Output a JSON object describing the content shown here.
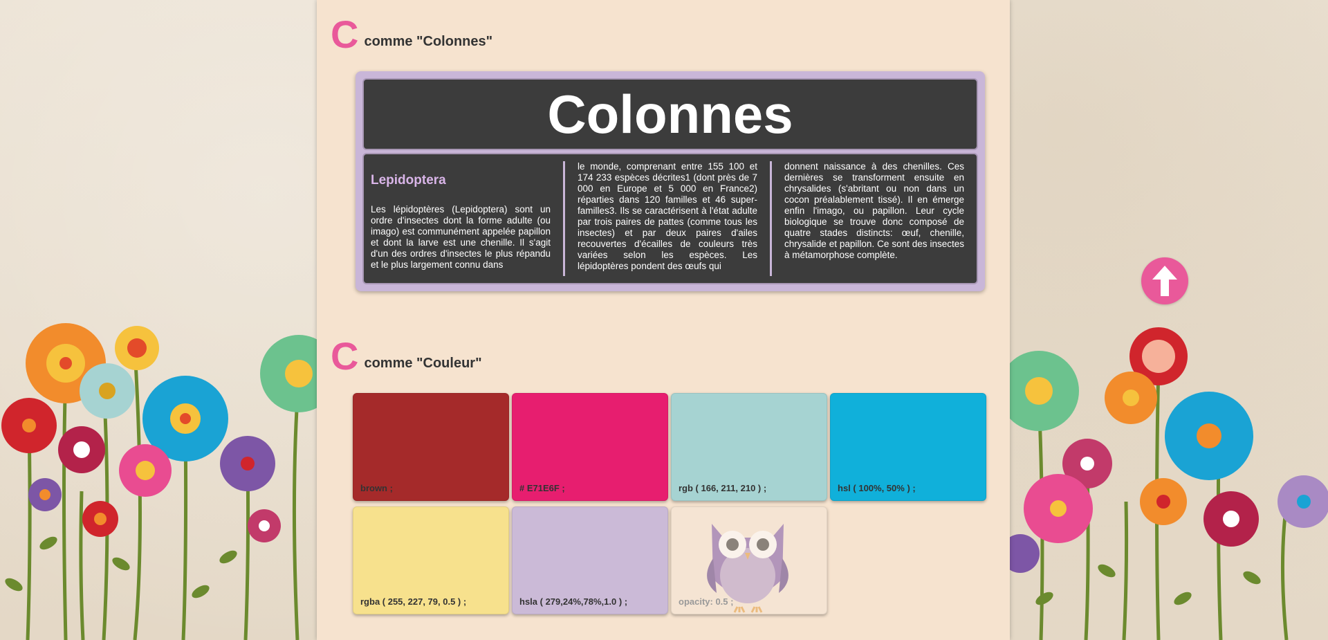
{
  "sections": {
    "colonnes": {
      "letter": "C",
      "title": "comme \"Colonnes\""
    },
    "couleur": {
      "letter": "C",
      "title": "comme \"Couleur\""
    }
  },
  "colonnes_demo": {
    "heading": "Colonnes",
    "subheading": "Lepidoptera",
    "col1": "Les lépidoptères (Lepidoptera) sont un ordre d'insectes dont la forme adulte (ou imago) est communément appelée papillon et dont la larve est une chenille. Il s'agit d'un des ordres d'insectes le plus répandu et le plus largement connu dans",
    "col2": "le monde, comprenant entre 155 100 et 174 233 espèces décrites1 (dont près de 7 000 en Europe et 5 000 en France2) réparties dans 120 familles et 46 super-familles3. Ils se caractérisent à l'état adulte par trois paires de pattes (comme tous les insectes) et par deux paires d'ailes recouvertes d'écailles de couleurs très variées selon les espèces. Les lépidoptères pondent des œufs qui",
    "col3": "donnent naissance à des chenilles. Ces dernières se transforment ensuite en chrysalides (s'abritant ou non dans un cocon préalablement tissé). Il en émerge enfin l'imago, ou papillon. Leur cycle biologique se trouve donc composé de quatre stades distincts: œuf, chenille, chrysalide et papillon. Ce sont des insectes à métamorphose complète."
  },
  "swatches": [
    {
      "label": "brown ;",
      "color": "#a52a2a"
    },
    {
      "label": "# E71E6F ;",
      "color": "#e71e6f"
    },
    {
      "label": "rgb ( 166, 211, 210 ) ;",
      "color": "#a6d3d2"
    },
    {
      "label": "hsl ( 100%, 50% ) ;",
      "color": "#10b0da"
    },
    {
      "label": "rgba ( 255, 227, 79, 0.5 ) ;",
      "color": "#f7e18d"
    },
    {
      "label": "hsla ( 279,24%,78%,1.0 ) ;",
      "color": "#cbbad7"
    },
    {
      "label": "opacity: 0.5 ;",
      "color": "#f5e4d3"
    }
  ],
  "icons": {
    "back_to_top": "arrow-up-icon",
    "owl": "owl-icon"
  }
}
